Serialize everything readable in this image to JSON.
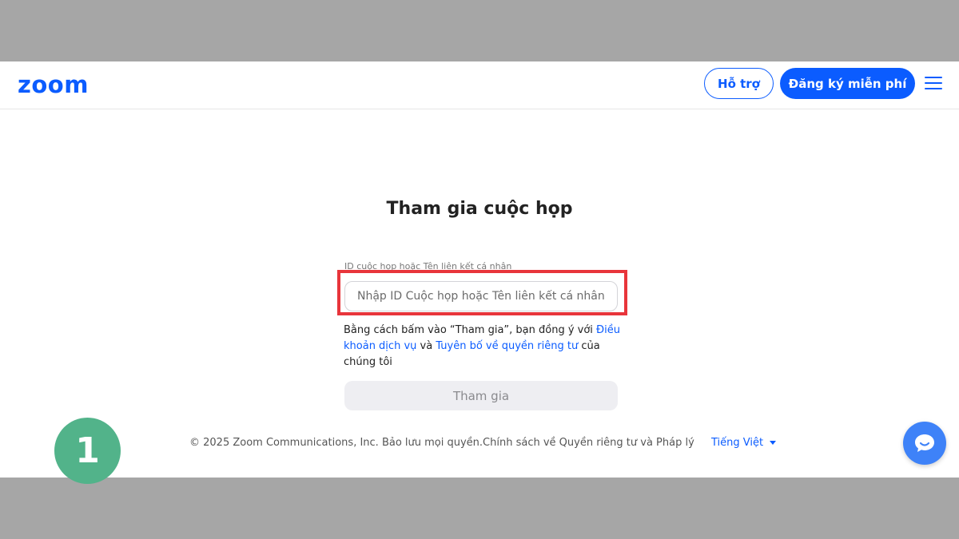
{
  "header": {
    "logo": "zoom",
    "support_label": "Hỗ trợ",
    "signup_label": "Đăng ký miễn phí",
    "menu_icon": "hamburger-menu-icon"
  },
  "main": {
    "title": "Tham gia cuộc họp",
    "field_label": "ID cuộc họp hoặc Tên liên kết cá nhân",
    "input_placeholder": "Nhập ID Cuộc họp hoặc Tên liên kết cá nhân",
    "input_value": "",
    "terms_prefix": "Bằng cách bấm vào “Tham gia”, bạn đồng ý với ",
    "terms_link": "Điều khoản dịch vụ",
    "terms_and": " và ",
    "privacy_link": "Tuyên bố về quyền riêng tư",
    "terms_suffix": " của chúng tôi",
    "join_label": "Tham gia"
  },
  "footer": {
    "copyright": "© 2025 Zoom Communications, Inc. Bảo lưu mọi quyền.Chính sách về Quyền riêng tư và Pháp lý",
    "language": "Tiếng Việt"
  },
  "overlay": {
    "step_number": "1"
  },
  "colors": {
    "brand": "#0b5cff",
    "highlight": "#e8353b",
    "step_badge": "#52b38a",
    "chat": "#3e82f8"
  }
}
